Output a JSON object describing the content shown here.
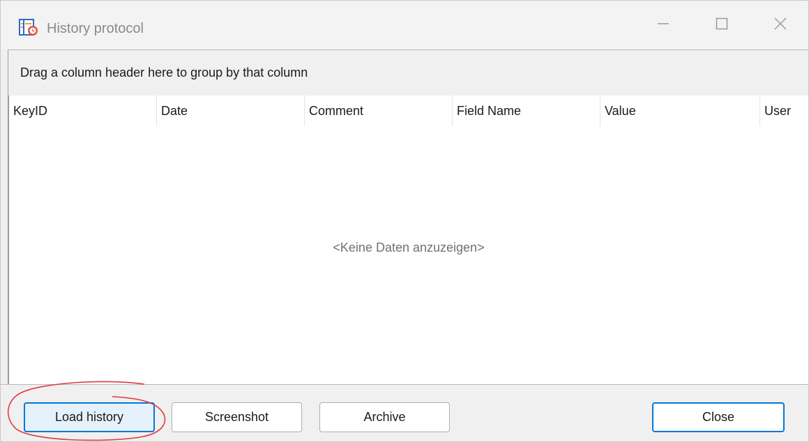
{
  "window": {
    "title": "History protocol",
    "icon": "history-app-icon",
    "controls": {
      "minimize_icon": "minimize-icon",
      "maximize_icon": "maximize-icon",
      "close_icon": "close-icon"
    }
  },
  "group_panel": {
    "text": "Drag a column header here to group by that column"
  },
  "grid": {
    "columns": [
      "KeyID",
      "Date",
      "Comment",
      "Field Name",
      "Value",
      "User"
    ],
    "empty_text": "<Keine Daten anzuzeigen>"
  },
  "buttons": {
    "load_history": "Load history",
    "screenshot": "Screenshot",
    "archive": "Archive",
    "close": "Close"
  },
  "colors": {
    "accent": "#0078d7",
    "annotation": "#e0393e"
  }
}
